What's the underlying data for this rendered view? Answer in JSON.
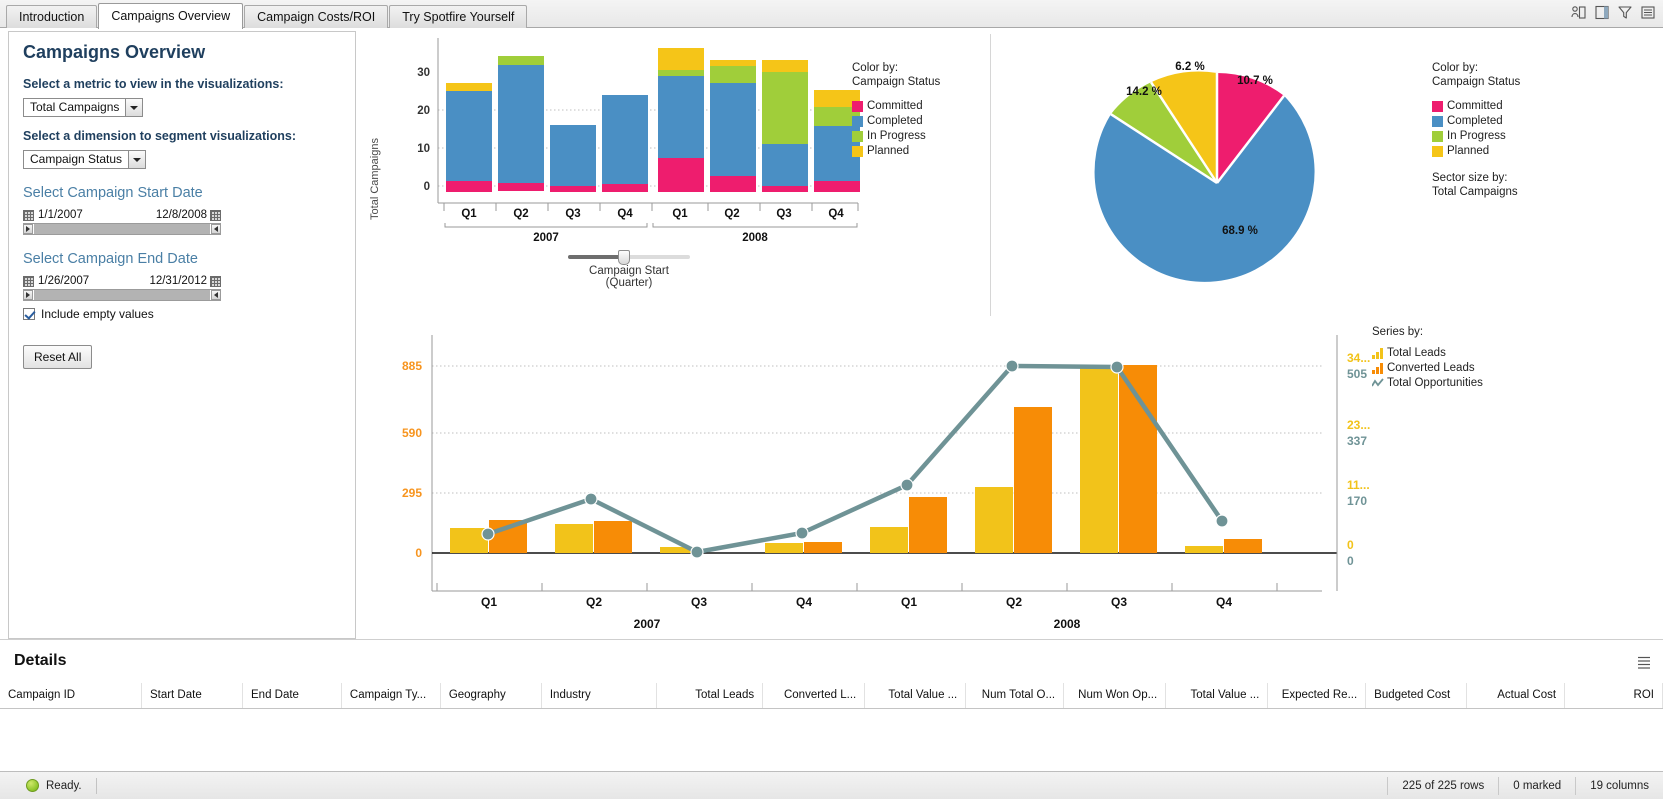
{
  "tabs": [
    {
      "label": "Introduction",
      "active": false
    },
    {
      "label": "Campaigns Overview",
      "active": true
    },
    {
      "label": "Campaign Costs/ROI",
      "active": false
    },
    {
      "label": "Try Spotfire Yourself",
      "active": false
    }
  ],
  "toolbar_icons": [
    "collaboration-icon",
    "panel-icon",
    "filter-icon",
    "list-icon"
  ],
  "sidebar": {
    "title": "Campaigns Overview",
    "metric_prompt": "Select a metric to view in the visualizations:",
    "metric_value": "Total Campaigns",
    "dimension_prompt": "Select a dimension to segment visualizations:",
    "dimension_value": "Campaign Status",
    "start_date_heading": "Select Campaign Start Date",
    "start_date_from": "1/1/2007",
    "start_date_to": "12/8/2008",
    "end_date_heading": "Select Campaign End Date",
    "end_date_from": "1/26/2007",
    "end_date_to": "12/31/2012",
    "include_empty_label": "Include empty values",
    "include_empty_checked": true,
    "reset_label": "Reset All"
  },
  "colors": {
    "committed": "#ee1d6e",
    "completed": "#4a8fc4",
    "in_progress": "#a0ce3a",
    "planned": "#f5c518",
    "total_leads": "#f2c31a",
    "converted_leads": "#f78c06",
    "opportunities": "#6f9396",
    "heading": "#1f3f5e",
    "section": "#4a7fa5"
  },
  "bar_legend": {
    "color_by_label": "Color by:",
    "color_by_value": "Campaign Status",
    "items": [
      {
        "label": "Committed",
        "color": "#ee1d6e"
      },
      {
        "label": "Completed",
        "color": "#4a8fc4"
      },
      {
        "label": "In Progress",
        "color": "#a0ce3a"
      },
      {
        "label": "Planned",
        "color": "#f5c518"
      }
    ]
  },
  "pie_legend": {
    "color_by_label": "Color by:",
    "color_by_value": "Campaign Status",
    "items": [
      {
        "label": "Committed",
        "color": "#ee1d6e"
      },
      {
        "label": "Completed",
        "color": "#4a8fc4"
      },
      {
        "label": "In Progress",
        "color": "#a0ce3a"
      },
      {
        "label": "Planned",
        "color": "#f5c518"
      }
    ],
    "sector_size_label": "Sector size by:",
    "sector_size_value": "Total Campaigns"
  },
  "combo_legend": {
    "series_by_label": "Series by:",
    "items": [
      {
        "label": "Total Leads",
        "icon": "bar-series-icon",
        "color": "#f2c31a"
      },
      {
        "label": "Converted Leads",
        "icon": "bar-series-icon",
        "color": "#f78c06"
      },
      {
        "label": "Total Opportunities",
        "icon": "line-series-icon",
        "color": "#6f9396"
      }
    ]
  },
  "slider_label": "Campaign Start (Quarter)",
  "details": {
    "title": "Details",
    "columns": [
      {
        "label": "Campaign ID",
        "align": "left"
      },
      {
        "label": "Start Date",
        "align": "left"
      },
      {
        "label": "End Date",
        "align": "left"
      },
      {
        "label": "Campaign Ty...",
        "align": "left"
      },
      {
        "label": "Geography",
        "align": "left"
      },
      {
        "label": "Industry",
        "align": "left"
      },
      {
        "label": "Total Leads",
        "align": "right"
      },
      {
        "label": "Converted L...",
        "align": "right"
      },
      {
        "label": "Total Value ...",
        "align": "right"
      },
      {
        "label": "Num Total O...",
        "align": "right"
      },
      {
        "label": "Num Won Op...",
        "align": "right"
      },
      {
        "label": "Total Value ...",
        "align": "right"
      },
      {
        "label": "Expected Re...",
        "align": "right"
      },
      {
        "label": "Budgeted Cost",
        "align": "left"
      },
      {
        "label": "Actual Cost",
        "align": "right"
      },
      {
        "label": "ROI",
        "align": "right"
      }
    ]
  },
  "status": {
    "ready": "Ready.",
    "rows": "225 of 225 rows",
    "marked": "0 marked",
    "columns": "19 columns"
  },
  "chart_data": [
    {
      "type": "bar",
      "id": "stacked-bar",
      "title": "",
      "ylabel": "Total Campaigns",
      "xlabel": "Campaign Start (Quarter)",
      "ylim": [
        0,
        37
      ],
      "yticks": [
        0,
        10,
        20,
        30
      ],
      "categories": [
        "Q1",
        "Q2",
        "Q3",
        "Q4",
        "Q1",
        "Q2",
        "Q3",
        "Q4"
      ],
      "group_labels": [
        "2007",
        "2008"
      ],
      "grid": true,
      "stacked": true,
      "series": [
        {
          "name": "Committed",
          "color": "#ee1d6e",
          "values": [
            1.5,
            0.6,
            -1.0,
            0.6,
            7.5,
            2.8,
            -1.0,
            1.5
          ]
        },
        {
          "name": "Completed",
          "color": "#4a8fc4",
          "values": [
            23.5,
            31.0,
            16.0,
            23.4,
            21.5,
            24.2,
            12.0,
            14.5
          ]
        },
        {
          "name": "In Progress",
          "color": "#a0ce3a",
          "values": [
            0,
            2.4,
            0,
            0,
            1.5,
            4.0,
            19.0,
            5.0
          ]
        },
        {
          "name": "Planned",
          "color": "#f5c518",
          "values": [
            2.0,
            0,
            0,
            0,
            6.0,
            1.0,
            2.0,
            4.0
          ]
        }
      ],
      "totals": [
        27,
        34,
        15,
        24,
        36,
        32,
        32,
        25
      ]
    },
    {
      "type": "pie",
      "id": "status-pie",
      "title": "",
      "sector_size_by": "Total Campaigns",
      "labels": [
        "Committed",
        "Completed",
        "In Progress",
        "Planned"
      ],
      "values": [
        10.7,
        68.9,
        14.2,
        6.2
      ],
      "value_labels": [
        "10.7 %",
        "68.9 %",
        "14.2 %",
        "6.2 %"
      ],
      "colors": [
        "#ee1d6e",
        "#4a8fc4",
        "#a0ce3a",
        "#f5c518"
      ]
    },
    {
      "type": "bar",
      "id": "leads-opportunities-combo",
      "title": "",
      "categories": [
        "Q1",
        "Q2",
        "Q3",
        "Q4",
        "Q1",
        "Q2",
        "Q3",
        "Q4"
      ],
      "group_labels": [
        "2007",
        "2008"
      ],
      "grid": true,
      "left_axis": {
        "ticks": [
          0,
          295,
          590,
          885
        ],
        "color": "#f7941e",
        "lim": [
          0,
          960
        ]
      },
      "right_axis_1": {
        "ticks": [
          "0",
          "11...",
          "23...",
          "34..."
        ],
        "color": "#f2c31a"
      },
      "right_axis_2": {
        "ticks": [
          "0",
          "170",
          "337",
          "505"
        ],
        "color": "#6f9396"
      },
      "series": [
        {
          "name": "Total Leads",
          "type": "bar",
          "color": "#f2c31a",
          "values": [
            105,
            135,
            20,
            55,
            115,
            320,
            880,
            0
          ]
        },
        {
          "name": "Converted Leads",
          "type": "bar",
          "color": "#f78c06",
          "values": [
            155,
            145,
            0,
            45,
            265,
            685,
            885,
            60
          ]
        },
        {
          "name": "Total Opportunities",
          "type": "line",
          "color": "#6f9396",
          "values": [
            80,
            300,
            10,
            85,
            375,
            885,
            880,
            155
          ]
        }
      ]
    }
  ]
}
